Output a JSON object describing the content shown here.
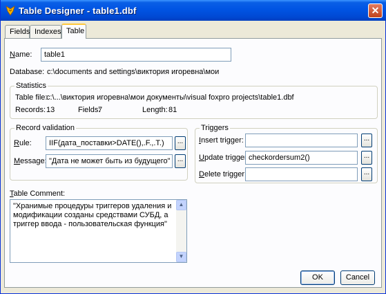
{
  "window": {
    "title": "Table Designer - table1.dbf",
    "close_label": "✕"
  },
  "tabs": [
    {
      "label": "Fields"
    },
    {
      "label": "Indexes"
    },
    {
      "label": "Table"
    }
  ],
  "name": {
    "label_first": "N",
    "label_rest": "ame:",
    "value": "table1"
  },
  "database": {
    "label": "Database:",
    "value": "c:\\documents and settings\\виктория игоревна\\мои"
  },
  "statistics": {
    "title": "Statistics",
    "table_file_label": "Table file:",
    "table_file_value": "c:\\...\\виктория игоревна\\мои документы\\visual foxpro projects\\table1.dbf",
    "records_label": "Records:",
    "records_value": "13",
    "fields_label": "Fields:",
    "fields_value": "7",
    "length_label": "Length:",
    "length_value": "81"
  },
  "record_validation": {
    "title": "Record validation",
    "rule_label_first": "R",
    "rule_label_rest": "ule:",
    "rule_value": "IIF(дата_поставки>DATE(),.F.,.T.)",
    "message_label_first": "M",
    "message_label_rest": "essage:",
    "message_value": "\"Дата  не может быть из будущего\"",
    "builder_label": "..."
  },
  "triggers": {
    "title": "Triggers",
    "insert_label_first": "I",
    "insert_label_rest": "nsert trigger:",
    "insert_value": "",
    "update_label_first": "U",
    "update_label_rest": "pdate trigger:",
    "update_value": "checkordersum2()",
    "delete_label_first": "D",
    "delete_label_rest": "elete trigger:",
    "delete_value": "",
    "builder_label": "..."
  },
  "comment": {
    "label_first": "T",
    "label_rest": "able Comment:",
    "value": "\"Хранимые процедуры триггеров удаления и модификации созданы средствами СУБД, а  триггер ввода - пользовательская функция\""
  },
  "buttons": {
    "ok": "OK",
    "cancel": "Cancel"
  },
  "colors": {
    "title_bar": "#0054e3",
    "dialog_bg": "#ece9d8",
    "panel_bg": "#fcfcfe",
    "tab_highlight": "#ffc83c"
  },
  "icons": {
    "app": "foxpro-icon",
    "close": "close-icon",
    "scroll_up": "scroll-up-icon",
    "scroll_down": "scroll-down-icon"
  }
}
